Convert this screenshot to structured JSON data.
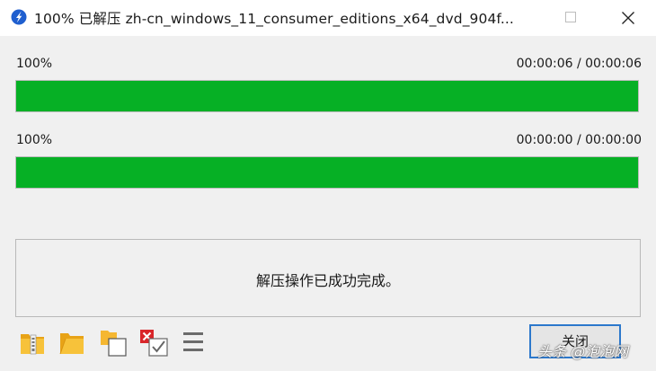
{
  "window": {
    "title": "100% 已解压 zh-cn_windows_11_consumer_editions_x64_dvd_904f..."
  },
  "progress_rows": [
    {
      "percent_label": "100%",
      "time_label": "00:00:06 / 00:00:06",
      "fraction": 1.0
    },
    {
      "percent_label": "100%",
      "time_label": "00:00:00 / 00:00:00",
      "fraction": 1.0
    }
  ],
  "status_message": "解压操作已成功完成。",
  "toolbar": {
    "icons": [
      "archive-folder-icon",
      "open-folder-icon",
      "copy-files-icon",
      "delete-checkbox-icon",
      "menu-icon"
    ]
  },
  "close_button_label": "关闭",
  "watermark": "头条 @泡泡网",
  "colors": {
    "progress_fill": "#06b025",
    "close_button_border": "#2c78cc",
    "title_bar_bg": "#ffffff",
    "window_bg": "#f0f0f0"
  }
}
